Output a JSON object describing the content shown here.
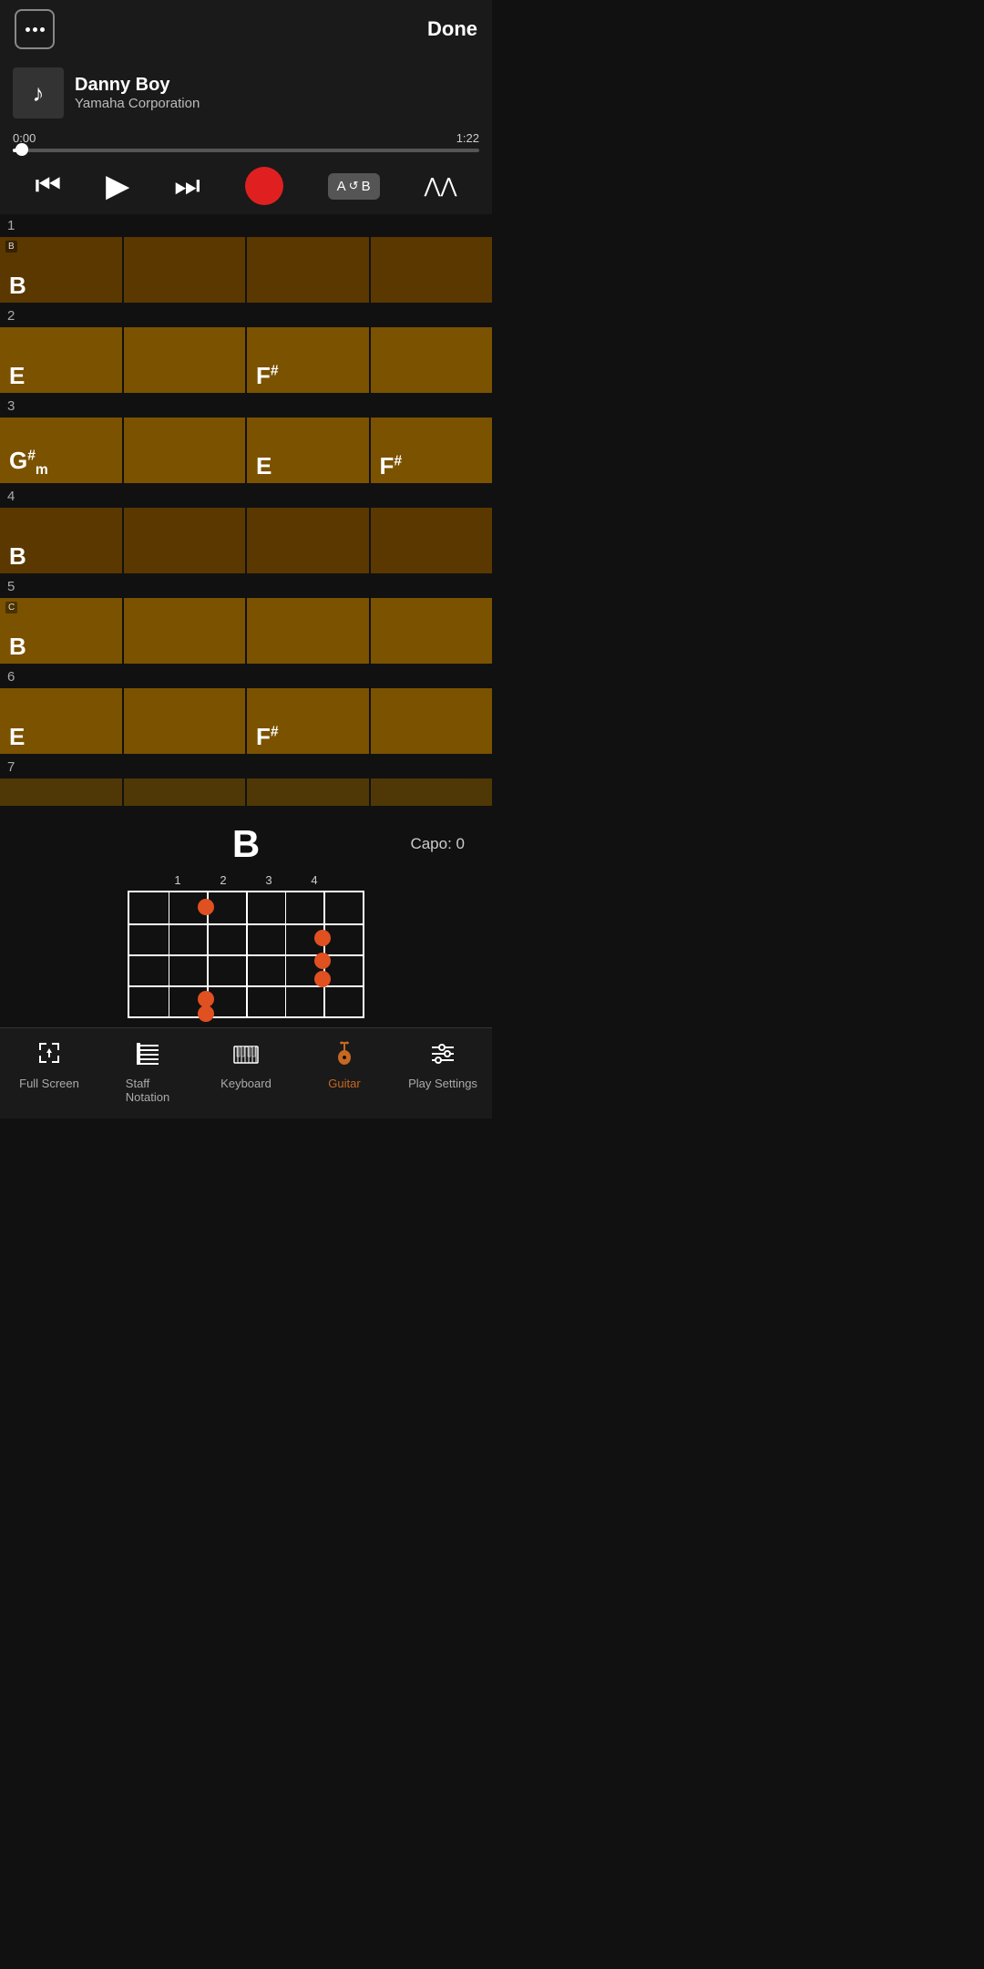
{
  "header": {
    "done_label": "Done",
    "dots_label": "..."
  },
  "player": {
    "track_title": "Danny Boy",
    "track_artist": "Yamaha Corporation",
    "time_current": "0:00",
    "time_total": "1:22",
    "progress_percent": 2
  },
  "transport": {
    "rewind_label": "⏮",
    "play_label": "▶",
    "fast_forward_label": "⏭",
    "record_label": "",
    "ab_label": "A↺B",
    "boost_label": "⋀⋀"
  },
  "chord_grid": {
    "rows": [
      {
        "row_num": "1",
        "cells": [
          {
            "chord": "B",
            "modifier": "",
            "label": "B",
            "lighter": false
          },
          {
            "chord": "",
            "modifier": "",
            "label": "",
            "lighter": false
          },
          {
            "chord": "",
            "modifier": "",
            "label": "",
            "lighter": false
          },
          {
            "chord": "",
            "modifier": "",
            "label": "",
            "lighter": false
          }
        ]
      },
      {
        "row_num": "2",
        "cells": [
          {
            "chord": "E",
            "modifier": "",
            "label": "",
            "lighter": true
          },
          {
            "chord": "",
            "modifier": "",
            "label": "",
            "lighter": true
          },
          {
            "chord": "F♯",
            "modifier": "",
            "label": "",
            "lighter": true
          },
          {
            "chord": "",
            "modifier": "",
            "label": "",
            "lighter": true
          }
        ]
      },
      {
        "row_num": "3",
        "cells": [
          {
            "chord": "G♯m",
            "modifier": "",
            "label": "",
            "lighter": true
          },
          {
            "chord": "",
            "modifier": "",
            "label": "",
            "lighter": true
          },
          {
            "chord": "E",
            "modifier": "",
            "label": "",
            "lighter": true
          },
          {
            "chord": "F♯",
            "modifier": "",
            "label": "",
            "lighter": true
          }
        ]
      },
      {
        "row_num": "4",
        "cells": [
          {
            "chord": "B",
            "modifier": "",
            "label": "",
            "lighter": false
          },
          {
            "chord": "",
            "modifier": "",
            "label": "",
            "lighter": false
          },
          {
            "chord": "",
            "modifier": "",
            "label": "",
            "lighter": false
          },
          {
            "chord": "",
            "modifier": "",
            "label": "",
            "lighter": false
          }
        ]
      },
      {
        "row_num": "5",
        "cells": [
          {
            "chord": "B",
            "modifier": "",
            "label": "C",
            "lighter": true
          },
          {
            "chord": "",
            "modifier": "",
            "label": "",
            "lighter": true
          },
          {
            "chord": "",
            "modifier": "",
            "label": "",
            "lighter": true
          },
          {
            "chord": "",
            "modifier": "",
            "label": "",
            "lighter": true
          }
        ]
      },
      {
        "row_num": "6",
        "cells": [
          {
            "chord": "E",
            "modifier": "",
            "label": "",
            "lighter": true
          },
          {
            "chord": "",
            "modifier": "",
            "label": "",
            "lighter": true
          },
          {
            "chord": "F♯",
            "modifier": "",
            "label": "",
            "lighter": true
          },
          {
            "chord": "",
            "modifier": "",
            "label": "",
            "lighter": true
          }
        ]
      },
      {
        "row_num": "7",
        "cells": [
          {
            "chord": "",
            "modifier": "",
            "label": "",
            "lighter": true
          },
          {
            "chord": "",
            "modifier": "",
            "label": "",
            "lighter": true
          },
          {
            "chord": "",
            "modifier": "",
            "label": "",
            "lighter": true
          },
          {
            "chord": "",
            "modifier": "",
            "label": "",
            "lighter": true
          }
        ]
      }
    ]
  },
  "chord_diagram": {
    "chord_name": "B",
    "capo_label": "Capo: 0",
    "fret_numbers": [
      "1",
      "2",
      "3",
      "4"
    ],
    "dots": [
      {
        "string_pct": 38,
        "fret_pct": 14,
        "note": "fret2 str2"
      },
      {
        "string_pct": 73,
        "fret_pct": 43,
        "note": "fret3 str4"
      },
      {
        "string_pct": 73,
        "fret_pct": 63,
        "note": "fret3 str5"
      },
      {
        "string_pct": 73,
        "fret_pct": 79,
        "note": "fret3 str5b"
      },
      {
        "string_pct": 38,
        "fret_pct": 93,
        "note": "fret2 str6"
      },
      {
        "string_pct": 38,
        "fret_pct": 107,
        "note": "fret2 str6b"
      }
    ]
  },
  "bottom_nav": {
    "items": [
      {
        "id": "fullscreen",
        "label": "Full Screen",
        "icon": "fullscreen",
        "active": false
      },
      {
        "id": "staff",
        "label": "Staff Notation",
        "icon": "staff",
        "active": false
      },
      {
        "id": "keyboard",
        "label": "Keyboard",
        "icon": "keyboard",
        "active": false
      },
      {
        "id": "guitar",
        "label": "Guitar",
        "icon": "guitar",
        "active": true
      },
      {
        "id": "settings",
        "label": "Play Settings",
        "icon": "settings",
        "active": false
      }
    ]
  }
}
